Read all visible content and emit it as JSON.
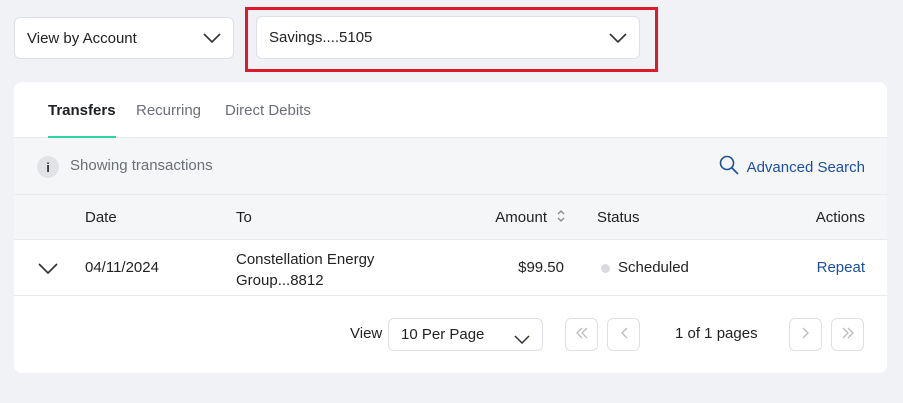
{
  "filters": {
    "view_by": "View by Account",
    "account": "Savings....5105"
  },
  "tabs": [
    {
      "label": "Transfers",
      "active": true
    },
    {
      "label": "Recurring",
      "active": false
    },
    {
      "label": "Direct Debits",
      "active": false
    }
  ],
  "info": {
    "icon": "info-icon",
    "text": "Showing transactions",
    "advanced_search": "Advanced Search"
  },
  "table": {
    "columns": [
      "Date",
      "To",
      "Amount",
      "Status",
      "Actions"
    ],
    "rows": [
      {
        "date": "04/11/2024",
        "to_line1": "Constellation Energy",
        "to_line2": "Group...8812",
        "amount": "$99.50",
        "status": "Scheduled",
        "action": "Repeat"
      }
    ]
  },
  "pagination": {
    "view_label": "View",
    "per_page": "10 Per Page",
    "page_info": "1 of 1 pages"
  },
  "colors": {
    "accent": "#2fd4a7",
    "link": "#1c4f9c",
    "highlight": "#e0182c"
  }
}
